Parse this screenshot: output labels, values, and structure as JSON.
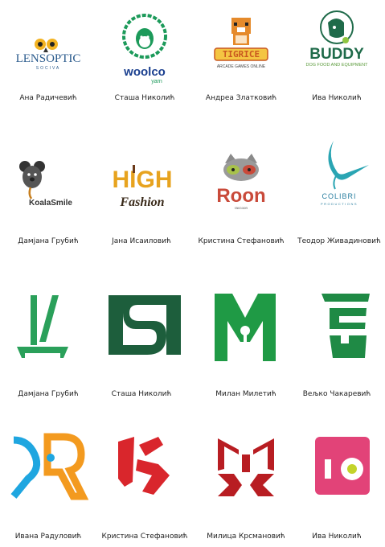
{
  "cards": [
    {
      "designer": "Ана Радичевић",
      "logo_text": "LENSOPTIC",
      "logo_sub": "SOCIVA"
    },
    {
      "designer": "Сташа Николић",
      "logo_text": "woolco",
      "logo_sub": "yarn"
    },
    {
      "designer": "Андреа Златковић",
      "logo_text": "TIGRICE",
      "logo_sub": "ARCADE GAMES ONLINE"
    },
    {
      "designer": "Ива Николић",
      "logo_text": "BUDDY",
      "logo_sub": "DOG FOOD AND EQUIPMENT"
    },
    {
      "designer": "Дамјана Грубић",
      "logo_text": "KoalaSmile",
      "logo_sub": ""
    },
    {
      "designer": "Јана Исаиловић",
      "logo_text": "HIGH",
      "logo_sub": "Fashion"
    },
    {
      "designer": "Кристина Стефановић",
      "logo_text": "Roon",
      "logo_sub": "raccoon"
    },
    {
      "designer": "Теодор Живадиновић",
      "logo_text": "COLIBRI",
      "logo_sub": "PRODUCTIONS"
    },
    {
      "designer": "Дамјана Грубић",
      "logo_text": "",
      "logo_sub": ""
    },
    {
      "designer": "Сташа Николић",
      "logo_text": "",
      "logo_sub": ""
    },
    {
      "designer": "Милан Милетић",
      "logo_text": "",
      "logo_sub": ""
    },
    {
      "designer": "Вељко Чакаревић",
      "logo_text": "",
      "logo_sub": ""
    },
    {
      "designer": "Ивана Радуловић",
      "logo_text": "",
      "logo_sub": ""
    },
    {
      "designer": "Кристина Стефановић",
      "logo_text": "",
      "logo_sub": ""
    },
    {
      "designer": "Милица Крсмановић",
      "logo_text": "",
      "logo_sub": ""
    },
    {
      "designer": "Ива Николић",
      "logo_text": "",
      "logo_sub": ""
    }
  ],
  "colors": {
    "text": "#222222",
    "lensoptic": "#2a5a8c",
    "woolco_green": "#1c9a5a",
    "woolco_blue": "#1a3f8f",
    "tigrice_orange": "#e58a2b",
    "buddy_green": "#1f6b4a",
    "koala": "#333333",
    "high_orange": "#e7a31f",
    "roon_red": "#c94a3a",
    "colibri_teal": "#2aa5b3",
    "green_logo": "#1f9a45",
    "dark_green": "#1d5e3c",
    "orange_blue_a": "#f39a1f",
    "orange_blue_b": "#1fa6e0",
    "red": "#d9262c",
    "crimson": "#b81d22",
    "pink": "#e24378",
    "lime": "#c3d32a"
  }
}
